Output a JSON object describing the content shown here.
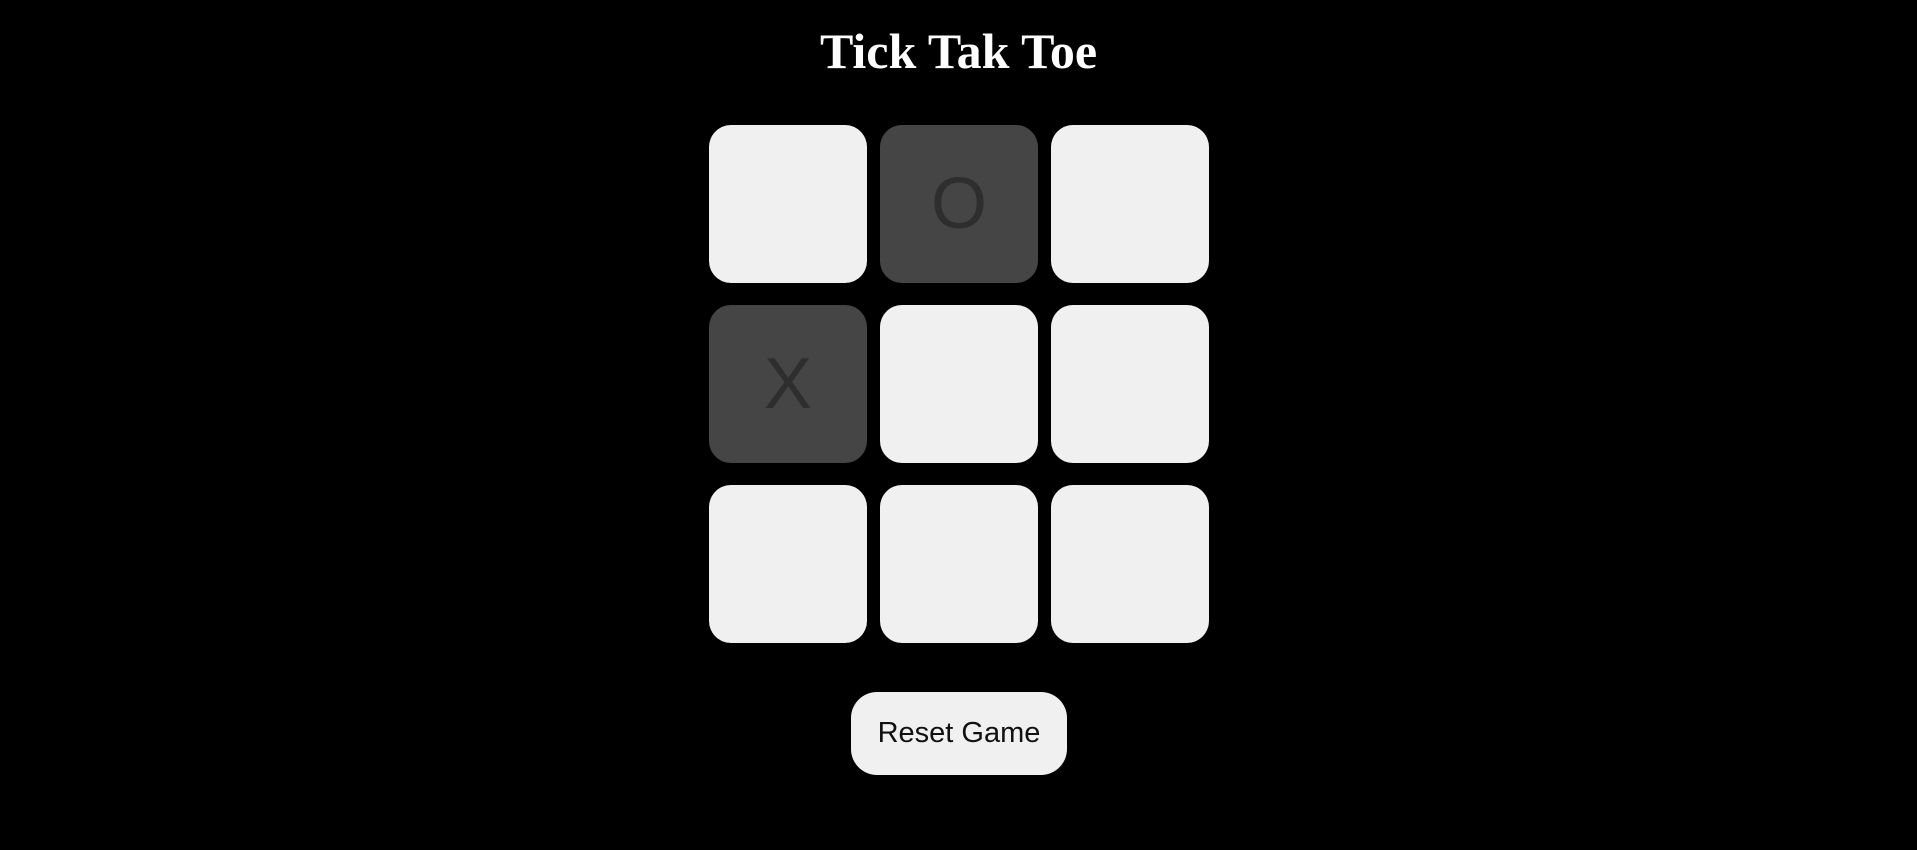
{
  "title": "Tick Tak Toe",
  "board": {
    "cells": [
      "",
      "O",
      "",
      "X",
      "",
      "",
      "",
      "",
      ""
    ]
  },
  "controls": {
    "reset_label": "Reset Game"
  },
  "colors": {
    "background": "#000000",
    "empty_cell": "#f0f0f0",
    "filled_cell": "#454545",
    "mark": "#2e2e2e"
  }
}
